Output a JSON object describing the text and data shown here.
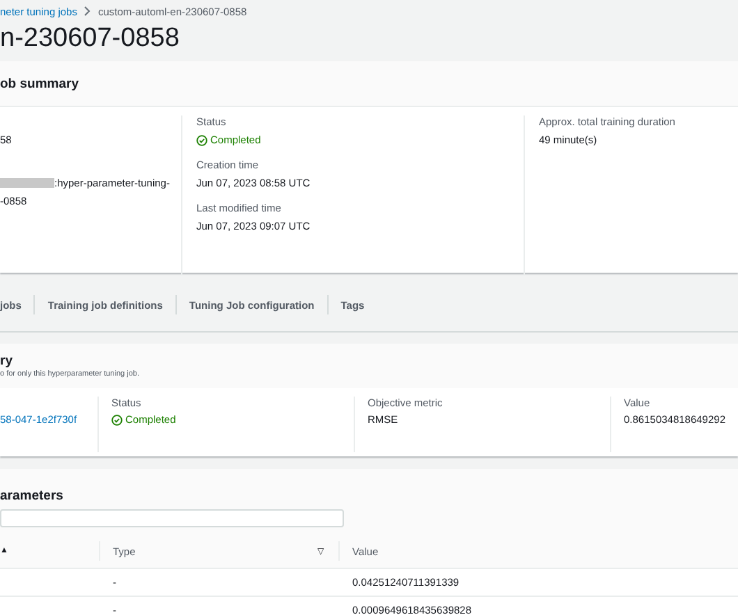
{
  "breadcrumb": [
    {
      "label": "neter tuning jobs",
      "kind": "link"
    },
    {
      "label": "custom-automl-en-230607-0858",
      "kind": "current"
    }
  ],
  "title": "n-230607-0858",
  "summary": {
    "title": "ob summary",
    "columns": [
      [
        {
          "value": "58"
        },
        {
          "value": ":hyper-parameter-tuning-",
          "value2": "-0858",
          "redacted": true
        }
      ],
      [
        {
          "label": "Status",
          "value": "Completed",
          "kind": "status"
        },
        {
          "label": "Creation time",
          "value": "Jun 07, 2023 08:58 UTC"
        },
        {
          "label": "Last modified time",
          "value": "Jun 07, 2023 09:07 UTC"
        }
      ],
      [
        {
          "label": "Approx. total training duration",
          "value": "49 minute(s)"
        }
      ]
    ]
  },
  "tabs": [
    {
      "label": "jobs",
      "selected": false
    },
    {
      "label": "Training job definitions",
      "selected": false
    },
    {
      "label": "Tuning Job configuration",
      "selected": false
    },
    {
      "label": "Tags",
      "selected": false
    }
  ],
  "best_job": {
    "title": "ry",
    "subtitle": "o for only this hyperparameter tuning job.",
    "fields": [
      {
        "value": "58-047-1e2f730f",
        "kind": "link"
      },
      {
        "label": "Status",
        "value": "Completed",
        "kind": "status"
      },
      {
        "label": "Objective metric",
        "value": "RMSE",
        "kind": "text"
      },
      {
        "label": "Value",
        "value": "0.8615034818649292",
        "kind": "text"
      }
    ]
  },
  "hyperparameters": {
    "title": "arameters",
    "columns": [
      {
        "sort": "▲"
      },
      {
        "label": "Type",
        "sort": "▽"
      },
      {
        "label": "Value"
      }
    ],
    "rows": [
      {
        "type": "-",
        "value": "0.04251240711391339"
      },
      {
        "type": "-",
        "value": "0.0009649618435639828"
      }
    ]
  }
}
